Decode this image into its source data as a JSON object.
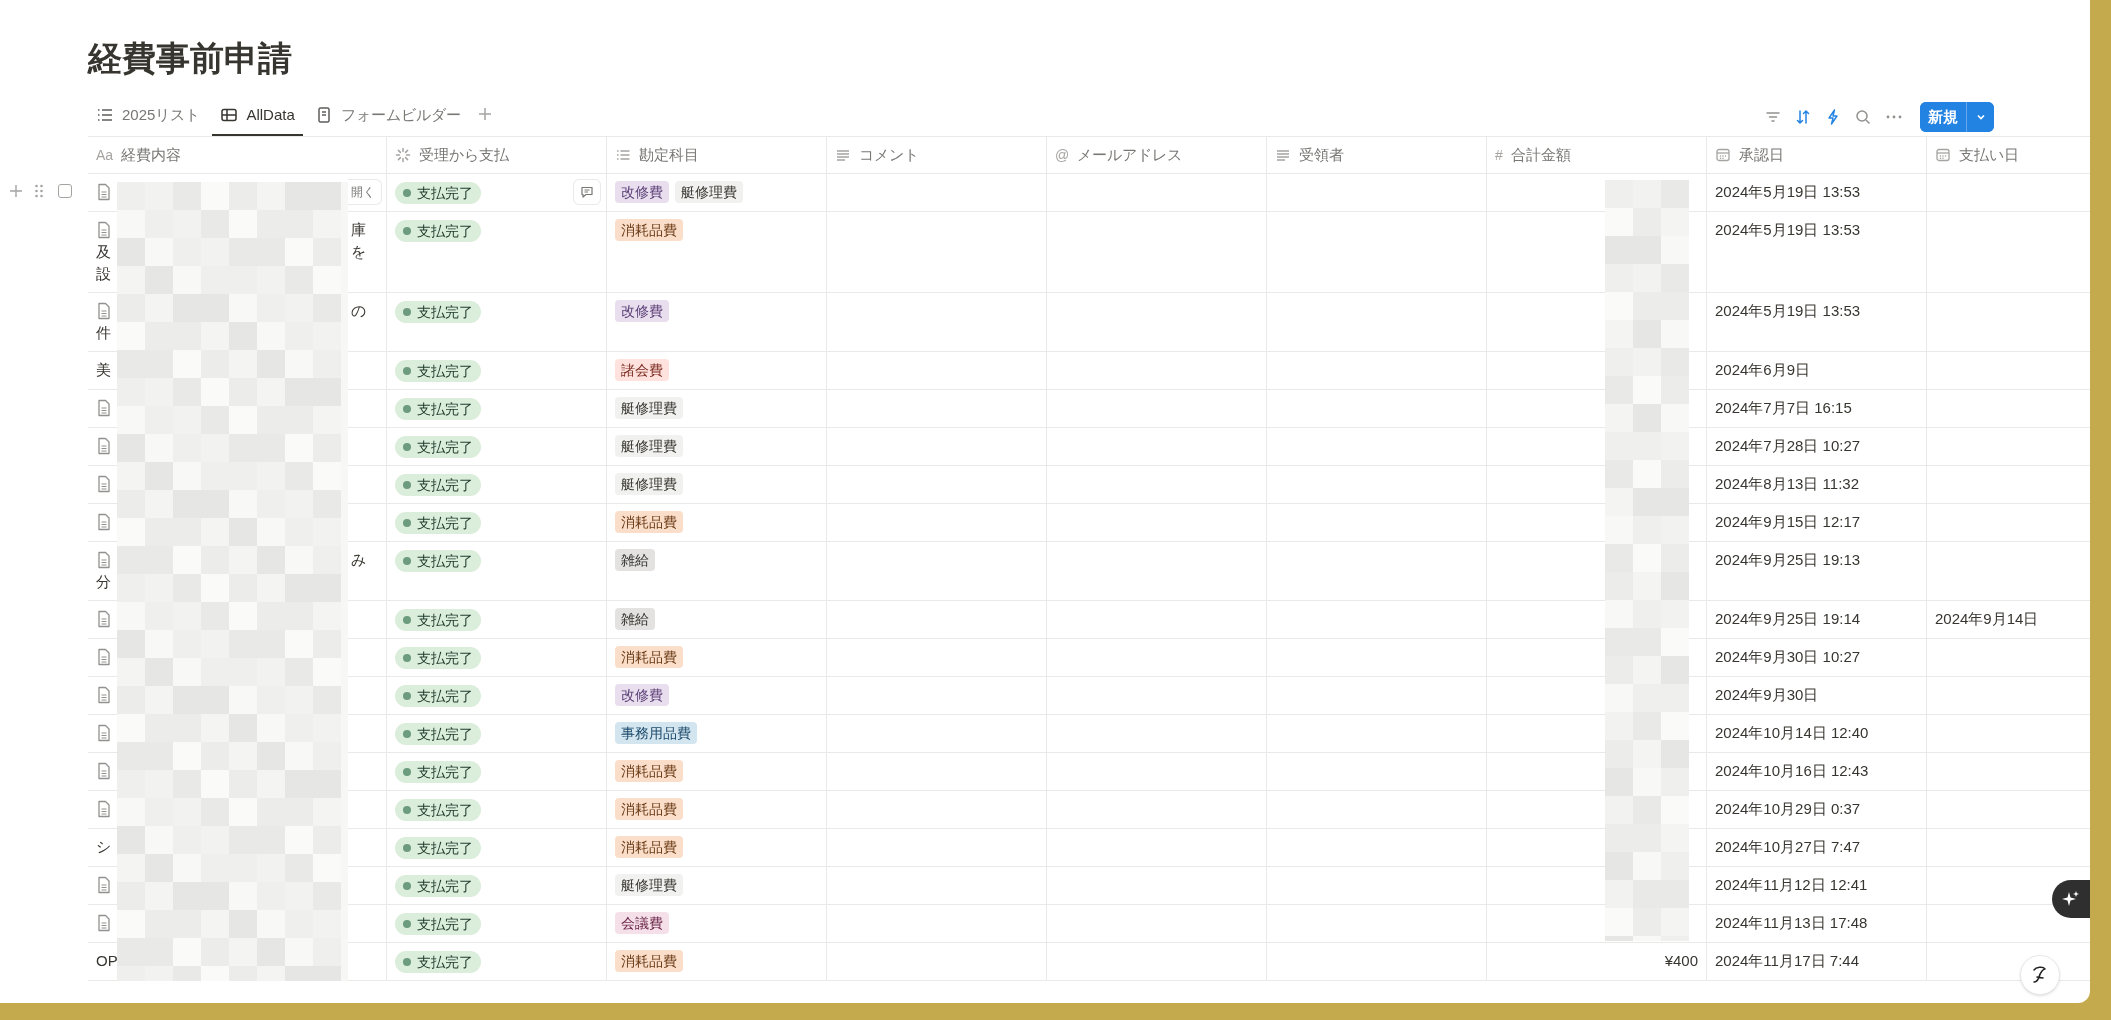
{
  "page_title": "経費事前申請",
  "tabs": [
    {
      "label": "2025リスト",
      "kind": "list",
      "selected": false
    },
    {
      "label": "AllData",
      "kind": "table",
      "selected": true
    },
    {
      "label": "フォームビルダー",
      "kind": "form",
      "selected": false
    }
  ],
  "new_button": "新規",
  "columns": [
    {
      "label": "経費内容",
      "kind": "title",
      "icon_text": "Aa"
    },
    {
      "label": "受理から支払",
      "kind": "status"
    },
    {
      "label": "勘定科目",
      "kind": "multi_select"
    },
    {
      "label": "コメント",
      "kind": "text"
    },
    {
      "label": "メールアドレス",
      "kind": "email",
      "icon_text": "@"
    },
    {
      "label": "受領者",
      "kind": "text"
    },
    {
      "label": "合計金額",
      "kind": "number",
      "icon_text": "#"
    },
    {
      "label": "承認日",
      "kind": "date"
    },
    {
      "label": "支払い日",
      "kind": "date"
    }
  ],
  "rows": [
    {
      "page_icon": true,
      "hovered": true,
      "checked": false,
      "open_label": "開く",
      "status": "支払完了",
      "tags": [
        {
          "label": "改修費",
          "color": "#e8deee"
        },
        {
          "label": "艇修理費",
          "color": "#f1f1ef"
        }
      ],
      "approved": "2024年5月19日 13:53"
    },
    {
      "page_icon": true,
      "hovered": false,
      "title_lines": [
        {
          "end": "庫"
        },
        {
          "start": "及",
          "end": "を"
        },
        {
          "start": "設"
        }
      ],
      "status": "支払完了",
      "tags": [
        {
          "label": "消耗品費",
          "color": "#fadec9"
        }
      ],
      "approved": "2024年5月19日 13:53"
    },
    {
      "page_icon": true,
      "hovered": false,
      "title_lines": [
        {
          "end": "の"
        },
        {
          "start": "件"
        }
      ],
      "status": "支払完了",
      "tags": [
        {
          "label": "改修費",
          "color": "#e8deee"
        }
      ],
      "approved": "2024年5月19日 13:53"
    },
    {
      "page_icon": false,
      "hovered": false,
      "title_lines": [
        {
          "start": "美"
        }
      ],
      "status": "支払完了",
      "tags": [
        {
          "label": "諸会費",
          "color": "#ffe2dd"
        }
      ],
      "approved": "2024年6月9日"
    },
    {
      "page_icon": true,
      "hovered": false,
      "status": "支払完了",
      "tags": [
        {
          "label": "艇修理費",
          "color": "#f1f1ef"
        }
      ],
      "approved": "2024年7月7日 16:15"
    },
    {
      "page_icon": true,
      "hovered": false,
      "status": "支払完了",
      "tags": [
        {
          "label": "艇修理費",
          "color": "#f1f1ef"
        }
      ],
      "approved": "2024年7月28日 10:27"
    },
    {
      "page_icon": true,
      "hovered": false,
      "status": "支払完了",
      "tags": [
        {
          "label": "艇修理費",
          "color": "#f1f1ef"
        }
      ],
      "approved": "2024年8月13日 11:32"
    },
    {
      "page_icon": true,
      "hovered": false,
      "status": "支払完了",
      "tags": [
        {
          "label": "消耗品費",
          "color": "#fadec9"
        }
      ],
      "approved": "2024年9月15日 12:17"
    },
    {
      "page_icon": true,
      "hovered": false,
      "title_lines": [
        {
          "end": "み"
        },
        {
          "start": "分"
        }
      ],
      "status": "支払完了",
      "tags": [
        {
          "label": "雑給",
          "color": "#e3e2e0"
        }
      ],
      "approved": "2024年9月25日 19:13"
    },
    {
      "page_icon": true,
      "hovered": false,
      "status": "支払完了",
      "tags": [
        {
          "label": "雑給",
          "color": "#e3e2e0"
        }
      ],
      "approved": "2024年9月25日 19:14",
      "paid": "2024年9月14日"
    },
    {
      "page_icon": true,
      "hovered": false,
      "status": "支払完了",
      "tags": [
        {
          "label": "消耗品費",
          "color": "#fadec9"
        }
      ],
      "approved": "2024年9月30日 10:27"
    },
    {
      "page_icon": true,
      "hovered": false,
      "status": "支払完了",
      "tags": [
        {
          "label": "改修費",
          "color": "#e8deee"
        }
      ],
      "approved": "2024年9月30日"
    },
    {
      "page_icon": true,
      "hovered": false,
      "status": "支払完了",
      "tags": [
        {
          "label": "事務用品費",
          "color": "#d3e5ef"
        }
      ],
      "approved": "2024年10月14日 12:40"
    },
    {
      "page_icon": true,
      "hovered": false,
      "status": "支払完了",
      "tags": [
        {
          "label": "消耗品費",
          "color": "#fadec9"
        }
      ],
      "approved": "2024年10月16日 12:43"
    },
    {
      "page_icon": true,
      "hovered": false,
      "status": "支払完了",
      "tags": [
        {
          "label": "消耗品費",
          "color": "#fadec9"
        }
      ],
      "approved": "2024年10月29日 0:37"
    },
    {
      "page_icon": false,
      "hovered": false,
      "title_lines": [
        {
          "start": "シ"
        }
      ],
      "status": "支払完了",
      "tags": [
        {
          "label": "消耗品費",
          "color": "#fadec9"
        }
      ],
      "approved": "2024年10月27日 7:47"
    },
    {
      "page_icon": true,
      "hovered": false,
      "status": "支払完了",
      "tags": [
        {
          "label": "艇修理費",
          "color": "#f1f1ef"
        }
      ],
      "approved": "2024年11月12日 12:41"
    },
    {
      "page_icon": true,
      "hovered": false,
      "status": "支払完了",
      "tags": [
        {
          "label": "会議費",
          "color": "#f5e0e9"
        }
      ],
      "approved": "2024年11月13日 17:48"
    },
    {
      "page_icon": false,
      "hovered": false,
      "title_lines": [
        {
          "start": "OP"
        }
      ],
      "status": "支払完了",
      "tags": [
        {
          "label": "消耗品費",
          "color": "#fadec9"
        }
      ],
      "amount": "¥400",
      "approved": "2024年11月17日 7:44"
    }
  ]
}
